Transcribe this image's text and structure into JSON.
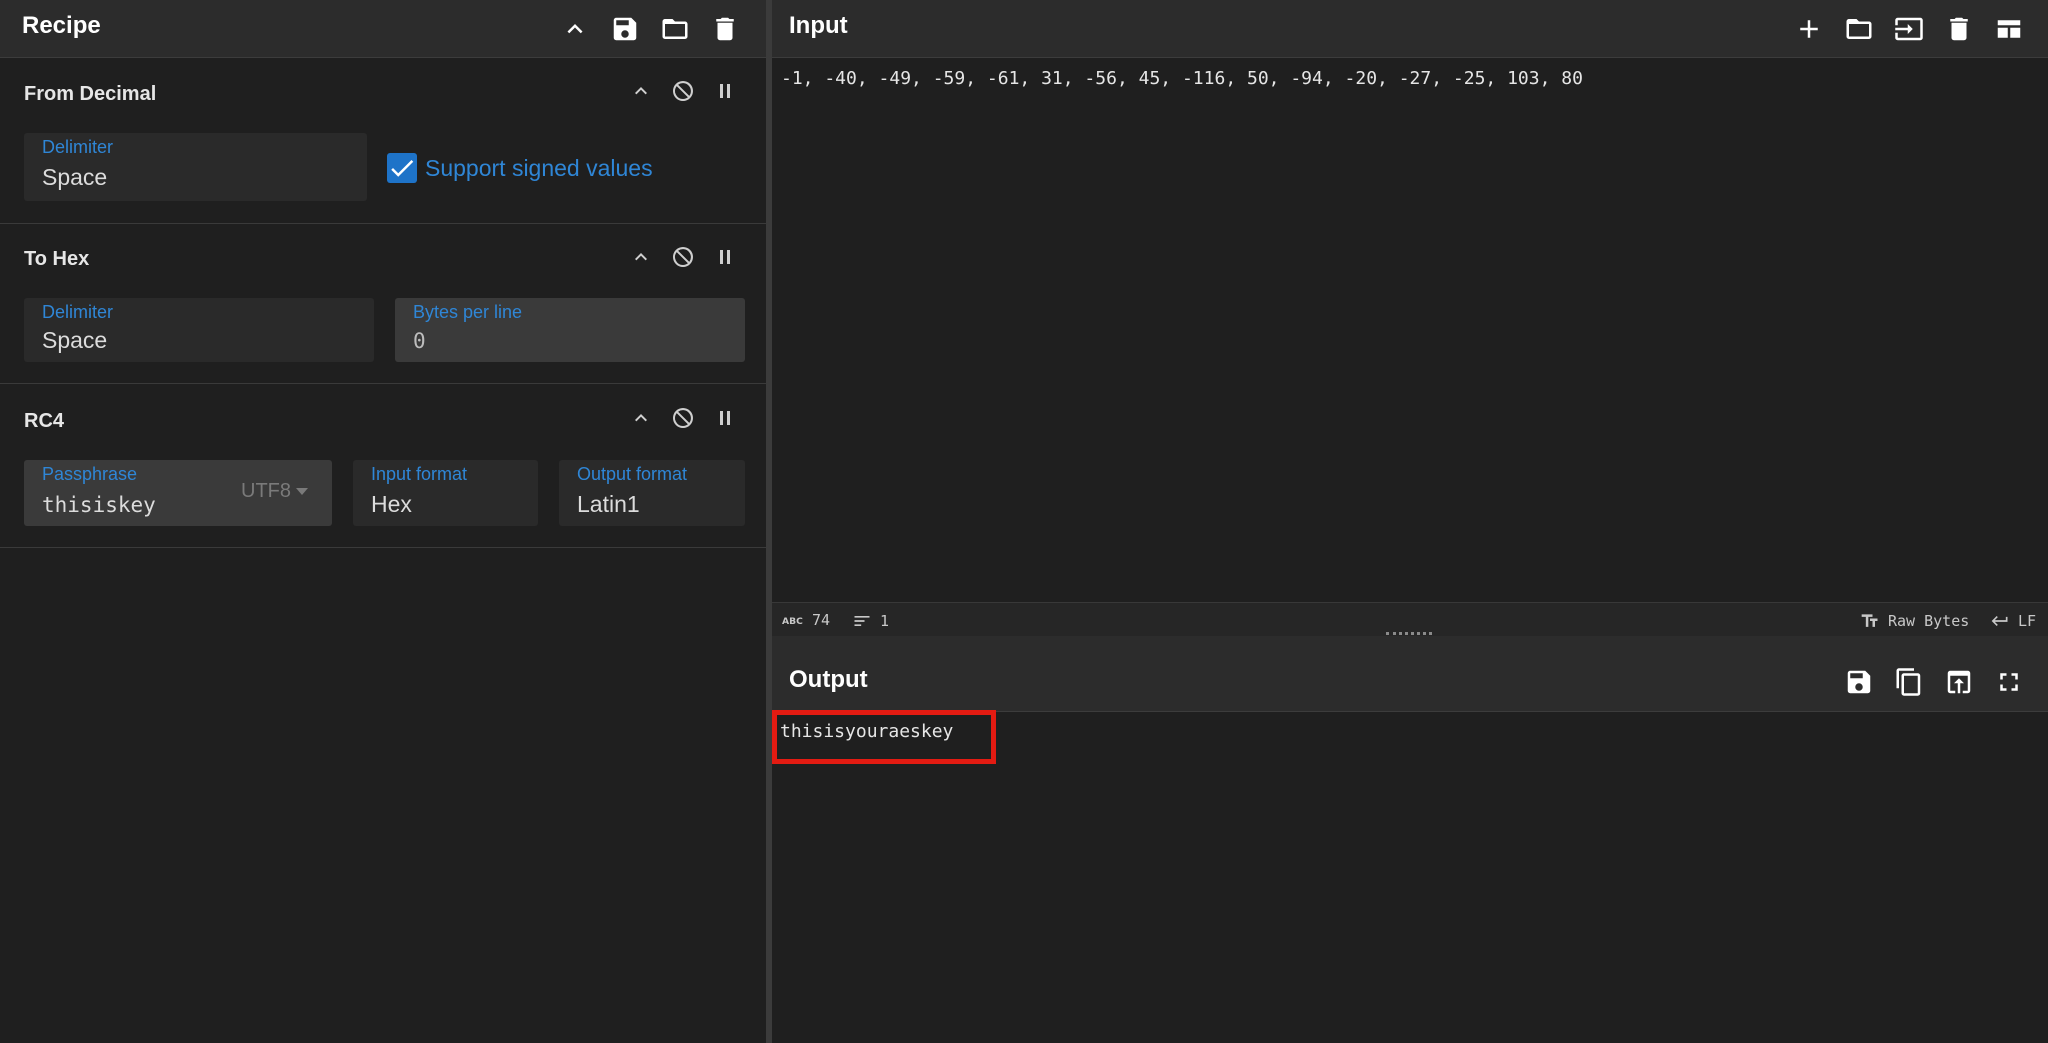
{
  "recipe": {
    "title": "Recipe",
    "icons": [
      "chevron-up-icon",
      "save-icon",
      "folder-icon",
      "trash-icon"
    ],
    "operations": [
      {
        "name": "From Decimal",
        "fields": [
          {
            "label": "Delimiter",
            "value": "Space"
          }
        ],
        "checkbox": {
          "label": "Support signed values",
          "checked": true
        }
      },
      {
        "name": "To Hex",
        "fields": [
          {
            "label": "Delimiter",
            "value": "Space"
          },
          {
            "label": "Bytes per line",
            "value": "0"
          }
        ]
      },
      {
        "name": "RC4",
        "fields": [
          {
            "label": "Passphrase",
            "value": "thisiskey",
            "encoding": "UTF8"
          },
          {
            "label": "Input format",
            "value": "Hex"
          },
          {
            "label": "Output format",
            "value": "Latin1"
          }
        ]
      }
    ]
  },
  "input": {
    "title": "Input",
    "text": "-1, -40, -49, -59, -61, 31, -56, 45, -116, 50, -94, -20, -27, -25, 103, 80",
    "status": {
      "length": "74",
      "lines": "1",
      "encoding": "Raw Bytes",
      "eol": "LF"
    }
  },
  "output": {
    "title": "Output",
    "text": "thisisyouraeskey"
  },
  "colors": {
    "accent": "#2f86d6",
    "highlight": "#e31b12",
    "background": "#1f1f1f",
    "header": "#2c2c2c"
  }
}
